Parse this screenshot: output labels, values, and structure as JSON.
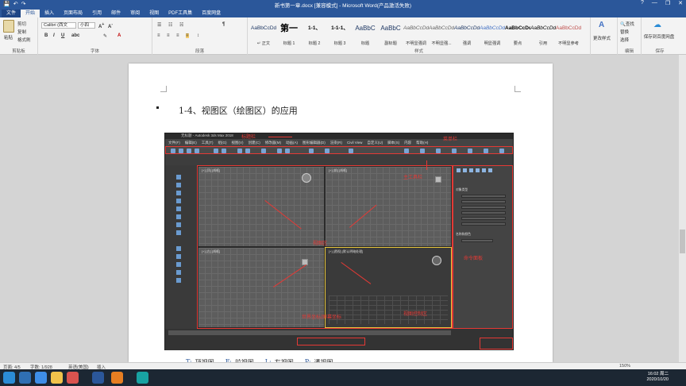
{
  "window": {
    "title": "新书第一章.docx [兼容模式] - Microsoft Word(产品激活失败)",
    "quick_access": [
      "💾",
      "↶",
      "↷"
    ],
    "controls": [
      "?",
      "—",
      "❐",
      "✕"
    ]
  },
  "tabs": [
    "文件",
    "开始",
    "插入",
    "页面布局",
    "引用",
    "邮件",
    "审阅",
    "视图",
    "PDF工具集",
    "百度网盘"
  ],
  "ribbon": {
    "clipboard": {
      "label": "剪贴板",
      "paste": "粘贴",
      "cut": "剪切",
      "copy": "复制",
      "format_painter": "格式刷"
    },
    "font": {
      "label": "字体",
      "family": "Calibri (西文",
      "size": "小四"
    },
    "paragraph": {
      "label": "段落"
    },
    "styles": {
      "label": "样式",
      "items": [
        {
          "sample": "AaBbCcDd",
          "name": "↵ 正文"
        },
        {
          "sample": "第一",
          "name": "标题 1"
        },
        {
          "sample": "1-1、",
          "name": "标题 2"
        },
        {
          "sample": "1-1-1、",
          "name": "标题 3"
        },
        {
          "sample": "AaBbC",
          "name": "标题"
        },
        {
          "sample": "AaBbC",
          "name": "副标题"
        },
        {
          "sample": "AaBbCcDd",
          "name": "不明显强调"
        },
        {
          "sample": "AaBbCcDd",
          "name": "不明显强..."
        },
        {
          "sample": "AaBbCcDd",
          "name": "强调"
        },
        {
          "sample": "AaBbCcDd",
          "name": "明显强调"
        },
        {
          "sample": "AaBbCcDd",
          "name": "要点"
        },
        {
          "sample": "AaBbCcDd",
          "name": "引用"
        },
        {
          "sample": "AaBbCcDd",
          "name": "不明显参考"
        }
      ],
      "change_styles": "更改样式"
    },
    "editing": {
      "label": "编辑",
      "find": "查找",
      "replace": "替换",
      "select": "选择"
    },
    "save": {
      "label": "保存",
      "button": "保存到百度网盘"
    }
  },
  "document": {
    "heading": "1-4、视图区（绘图区）的应用",
    "caption": [
      {
        "key": "T:",
        "text": "顶视图"
      },
      {
        "key": "F:",
        "text": "前视图"
      },
      {
        "key": "L:",
        "text": "左视图"
      },
      {
        "key": "P:",
        "text": "透视图"
      }
    ],
    "screenshot": {
      "app_title": "无标题 - Autodesk 3ds Max 2018",
      "menu": [
        "文件(F)",
        "编辑(E)",
        "工具(T)",
        "组(G)",
        "视图(V)",
        "创建(C)",
        "修改器(M)",
        "动画(A)",
        "图形编辑器(D)",
        "渲染(R)",
        "Civil View",
        "自定义(U)",
        "脚本(S)",
        "内容",
        "帮助(H)"
      ],
      "viewports": [
        "[+] [顶] [线框]",
        "[+] [前] [线框]",
        "[+] [左] [线框]",
        "[+] [透视] [默认明暗处理]"
      ],
      "annotations": {
        "title_bar": "标题栏",
        "menu_bar": "菜单栏",
        "main_toolbar": "主工具栏",
        "viewport": "视图区",
        "command_panel": "命令面板",
        "coords": "世界坐标/屏幕坐标",
        "viewport_control": "视图控制区"
      },
      "command_panel_items": [
        "对象类型",
        "长方体",
        "圆锥体",
        "球体",
        "几何球体",
        "圆柱体",
        "管状体",
        "圆环",
        "四棱锥",
        "茶壶",
        "平面",
        "加强型文本",
        "名称和颜色"
      ]
    }
  },
  "status": {
    "page": "页面: 4/5",
    "words": "字数: 1/928",
    "lang": "英语(美国)",
    "mode": "插入",
    "zoom": "150%"
  },
  "taskbar": {
    "time": "16:02 周二",
    "date": "2020/10/20"
  }
}
